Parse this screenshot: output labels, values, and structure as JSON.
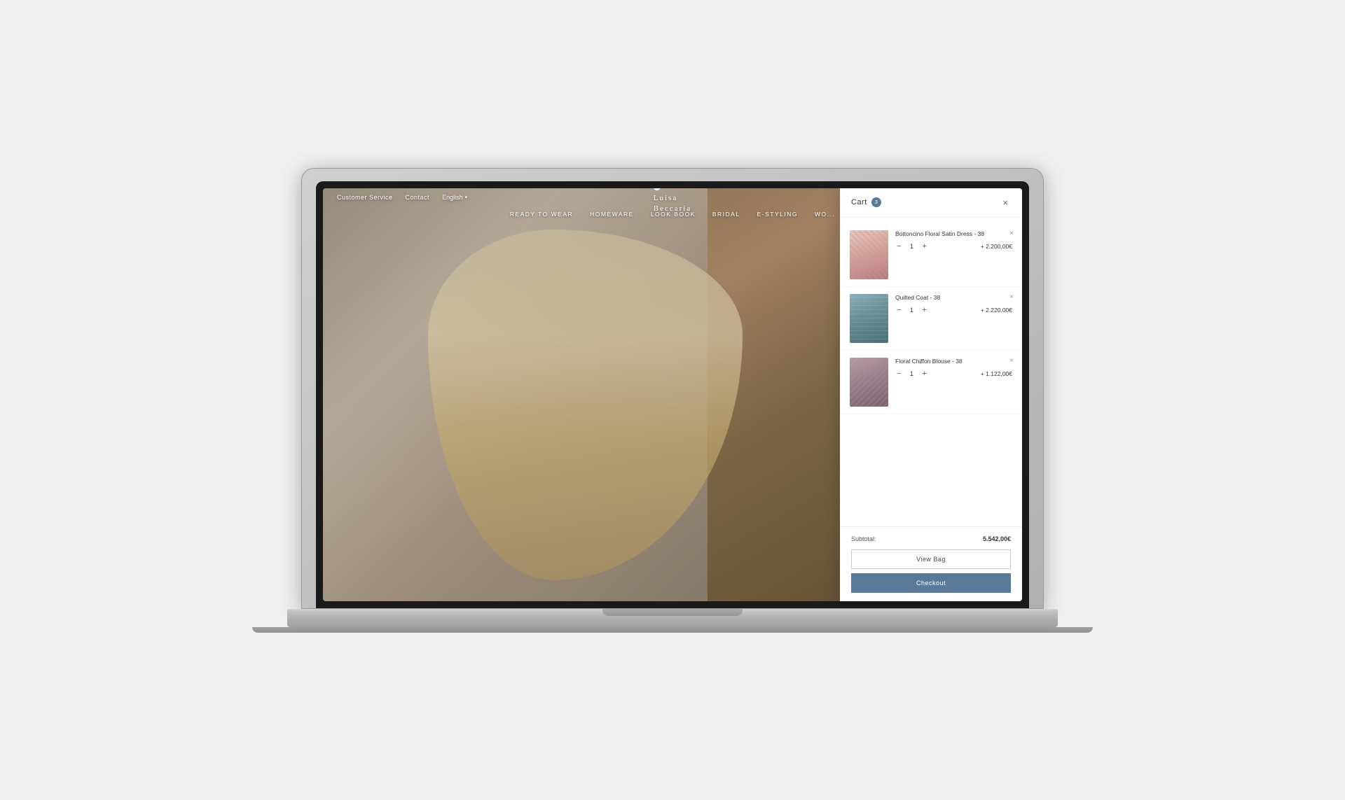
{
  "laptop": {
    "screen_badge": "3"
  },
  "website": {
    "top_bar": {
      "customer_service": "Customer Service",
      "contact": "Contact",
      "language": "English",
      "chevron": "▾"
    },
    "logo": {
      "drop_icon": "◆",
      "line1": "Luisa",
      "line2": "Beccaria"
    },
    "nav": {
      "items": [
        {
          "label": "READY TO WEAR"
        },
        {
          "label": "HOMEWARE"
        },
        {
          "label": "LOOK BOOK"
        },
        {
          "label": "BRIDAL"
        },
        {
          "label": "E-STYLING"
        },
        {
          "label": "WO..."
        }
      ]
    }
  },
  "cart": {
    "title": "Cart",
    "badge": "3",
    "close_icon": "×",
    "items": [
      {
        "id": 1,
        "name": "Bottoncino Floral Satin Dress - 38",
        "quantity": 1,
        "price": "+ 2.200,00€",
        "remove_icon": "×"
      },
      {
        "id": 2,
        "name": "Quilted Coat - 38",
        "quantity": 1,
        "price": "+ 2.220,00€",
        "remove_icon": "×"
      },
      {
        "id": 3,
        "name": "Floral Chiffon Blouse - 38",
        "quantity": 1,
        "price": "+ 1.122,00€",
        "remove_icon": "×"
      }
    ],
    "subtotal_label": "Subtotal:",
    "subtotal_value": "5.542,00€",
    "view_bag_label": "View Bag",
    "checkout_label": "Checkout",
    "qty_minus": "−",
    "qty_plus": "+"
  }
}
